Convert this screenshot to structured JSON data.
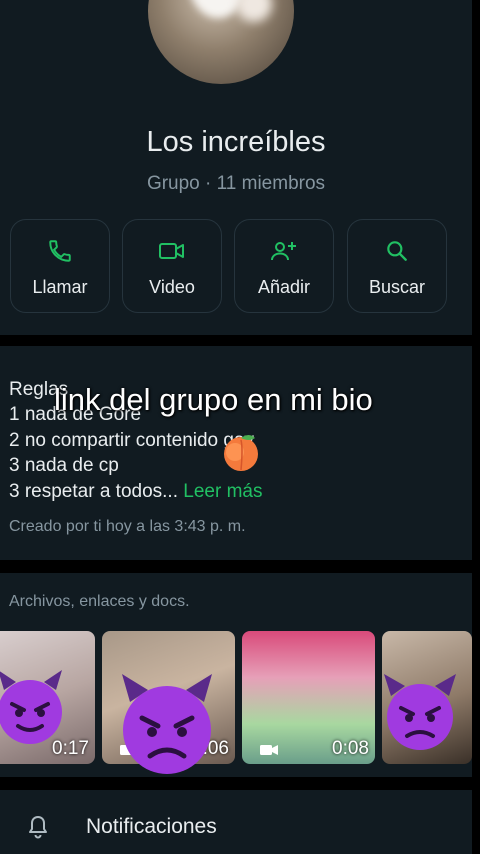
{
  "group": {
    "name": "Los increíbles",
    "subtitle": "Grupo · 11 miembros"
  },
  "actions": [
    {
      "label": "Llamar",
      "icon": "phone-icon"
    },
    {
      "label": "Video",
      "icon": "video-icon"
    },
    {
      "label": "Añadir",
      "icon": "add-person-icon"
    },
    {
      "label": "Buscar",
      "icon": "search-icon"
    }
  ],
  "description": {
    "lines": [
      "Reglas",
      "1 nada de Gore",
      "2 no compartir contenido gay",
      "3 nada de cp",
      "3 respetar a todos..."
    ],
    "read_more": "Leer más",
    "created": "Creado por ti hoy a las 3:43 p. m."
  },
  "overlay": {
    "caption": "link del grupo en mi bio"
  },
  "media": {
    "title": "Archivos, enlaces y docs.",
    "items": [
      {
        "duration": "0:17"
      },
      {
        "duration": "0:06"
      },
      {
        "duration": "0:08"
      },
      {
        "duration": ""
      }
    ]
  },
  "notifications": {
    "label": "Notificaciones"
  },
  "colors": {
    "background": "#111b21",
    "accent": "#21c063",
    "text": "#e9edef",
    "muted": "#8696a0"
  }
}
